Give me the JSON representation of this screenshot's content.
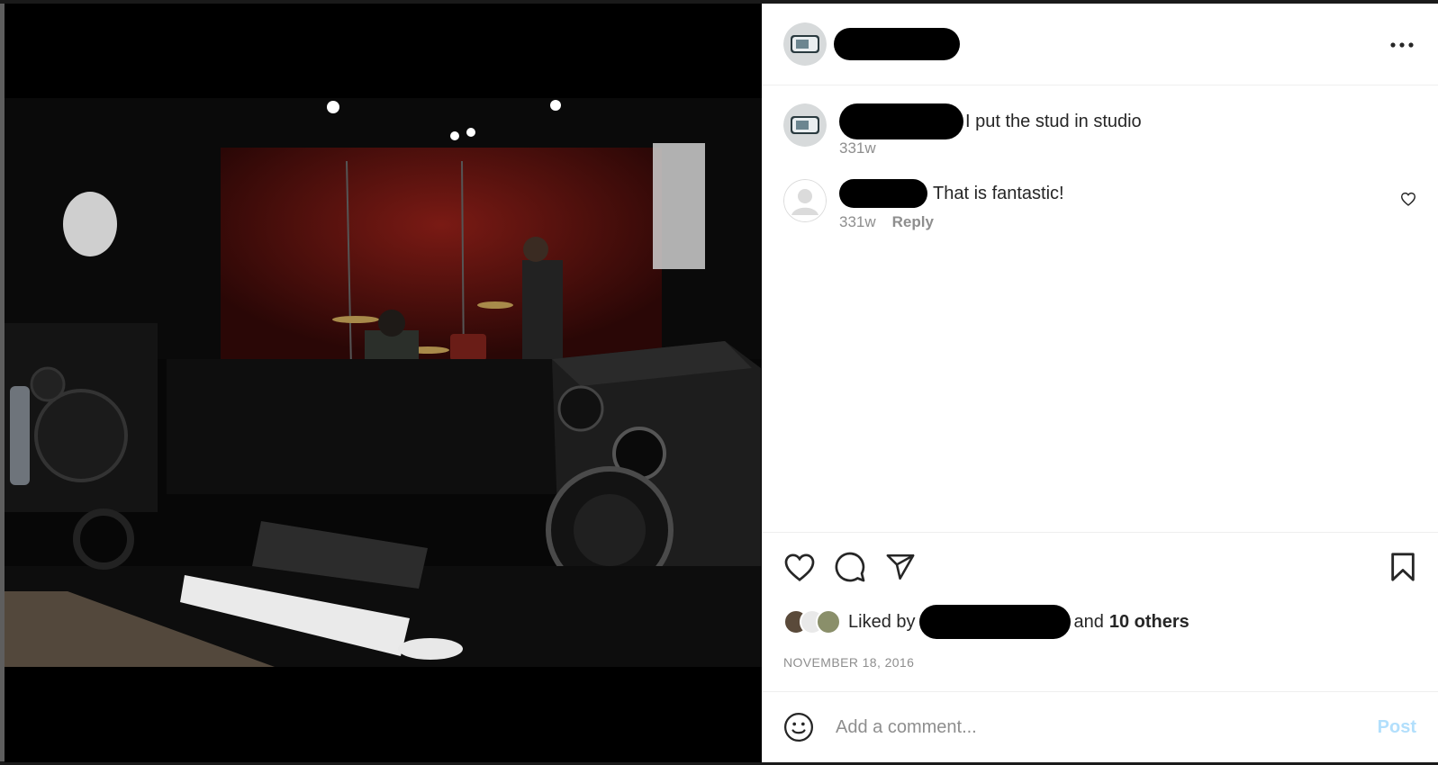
{
  "post": {
    "header": {
      "more_label": "..."
    },
    "caption": {
      "text": "I put the stud in studio",
      "age": "331w"
    },
    "comments": [
      {
        "text": "That is fantastic!",
        "age": "331w",
        "reply_label": "Reply"
      }
    ],
    "likes": {
      "prefix": "Liked by",
      "joiner": "and",
      "others": "10 others"
    },
    "date": "NOVEMBER 18, 2016",
    "add_comment": {
      "placeholder": "Add a comment...",
      "post_label": "Post"
    }
  },
  "icons": {
    "like": "heart-icon",
    "comment": "speech-bubble-icon",
    "share": "paper-plane-icon",
    "save": "bookmark-icon",
    "emoji": "smiley-icon",
    "more": "ellipsis-icon"
  },
  "colors": {
    "post_button": "#b2dffc",
    "muted_text": "#8e8e8e",
    "text": "#262626"
  }
}
